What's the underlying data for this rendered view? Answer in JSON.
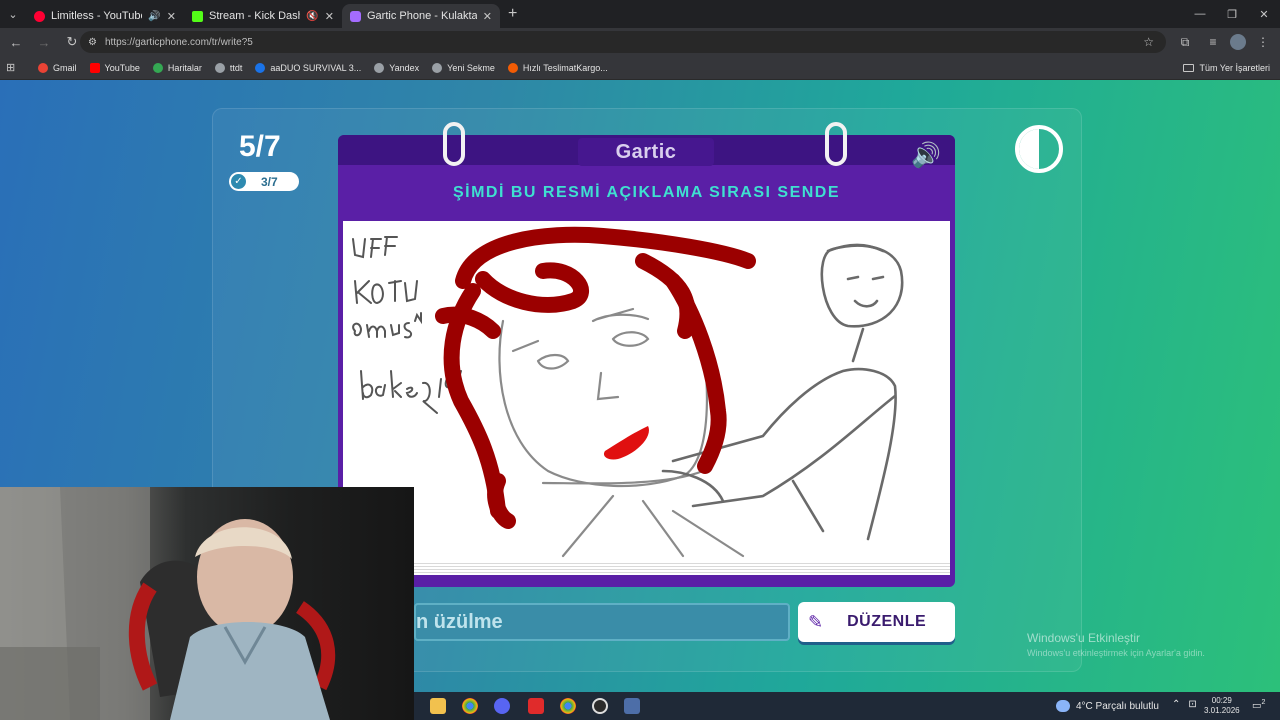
{
  "browser": {
    "tabs": [
      {
        "title": "Limitless - YouTube Music",
        "color": "#ff0033",
        "status_icon": "speaker-icon"
      },
      {
        "title": "Stream - Kick Dashboard",
        "color": "#53fc18",
        "status_icon": "muted-speaker-icon"
      },
      {
        "title": "Gartic Phone - Kulaktan Kulağa",
        "color": "#a46cff",
        "active": true
      }
    ],
    "url": "https://garticphone.com/tr/write?5",
    "bookmarks": [
      {
        "label": "Gmail",
        "color": "#ea4335"
      },
      {
        "label": "YouTube",
        "color": "#ff0000"
      },
      {
        "label": "Haritalar",
        "color": "#34a853"
      },
      {
        "label": "ttdt",
        "color": "#9aa0a6"
      },
      {
        "label": "aaDUO SURVIVAL 3...",
        "color": "#1a73e8"
      },
      {
        "label": "Yandex",
        "color": "#9aa0a6"
      },
      {
        "label": "Yeni Sekme",
        "color": "#9aa0a6"
      },
      {
        "label": "Hızlı TeslimatKargo...",
        "color": "#f25c05"
      }
    ],
    "all_bookmarks": "Tüm Yer İşaretleri"
  },
  "game": {
    "round": "5/7",
    "done": "3/7",
    "brand": "Gartic",
    "instruction": "ŞİMDİ BU RESMİ AÇIKLAMA SIRASI SENDE",
    "drawing_text": [
      "UFF",
      "KÖTÜ",
      "olmuş",
      "bakığım"
    ],
    "answer_value": "n üzülme",
    "edit_button": "DÜZENLE",
    "accent_color": "#5a1fa6",
    "instruction_color": "#3fe0d0"
  },
  "watermark": {
    "title": "Windows'u Etkinleştir",
    "subtitle": "Windows'u etkinleştirmek için Ayarlar'a gidin."
  },
  "taskbar": {
    "weather": "4°C  Parçalı bulutlu",
    "time": "00:29",
    "date": "3.01.2026",
    "notifications": "2"
  }
}
